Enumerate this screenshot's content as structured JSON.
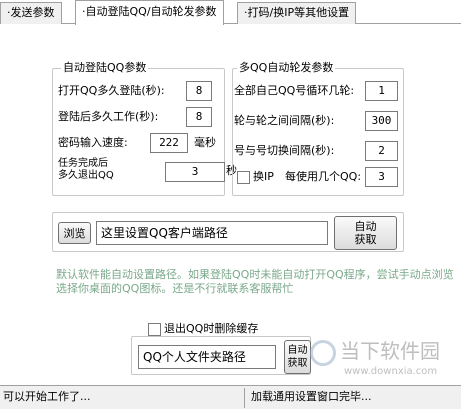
{
  "tabs": [
    {
      "label": "·发送参数"
    },
    {
      "label": "·自动登陆QQ/自动轮发参数"
    },
    {
      "label": "·打码/换IP等其他设置"
    }
  ],
  "auto_login": {
    "title": "自动登陆QQ参数",
    "open_delay_label": "打开QQ多久登陆(秒):",
    "open_delay_value": "8",
    "work_delay_label": "登陆后多久工作(秒):",
    "work_delay_value": "8",
    "pwd_speed_label": "密码输入速度:",
    "pwd_speed_value": "222",
    "pwd_speed_unit": "毫秒",
    "exit_label": "任务完成后\n多久退出QQ",
    "exit_value": "3",
    "exit_unit": "秒"
  },
  "multi_qq": {
    "title": "多QQ自动轮发参数",
    "loop_label": "全部自己QQ号循环几轮:",
    "loop_value": "1",
    "round_interval_label": "轮与轮之间间隔(秒):",
    "round_interval_value": "300",
    "switch_interval_label": "号与号切换间隔(秒):",
    "switch_interval_value": "2",
    "change_ip_label": "换IP",
    "per_ip_label": "每使用几个QQ:",
    "per_ip_value": "3"
  },
  "client_path": {
    "browse_label": "浏览",
    "path_value": "这里设置QQ客户端路径",
    "auto_get_label": "自动\n获取"
  },
  "note_text": "默认软件能自动设置路径。如果登陆QQ时未能自动打开QQ程序，尝试手动点浏览选择你桌面的QQ图标。还是不行就联系客服帮忙",
  "cache": {
    "checkbox_label": "退出QQ时删除缓存",
    "folder_path_value": "QQ个人文件夹路径",
    "auto_get_label": "自动\n获取"
  },
  "status": {
    "left": "可以开始工作了...",
    "right": "加载通用设置窗口完毕..."
  },
  "watermark": {
    "brand": "当下软件园",
    "url": "www.downxia.com"
  }
}
